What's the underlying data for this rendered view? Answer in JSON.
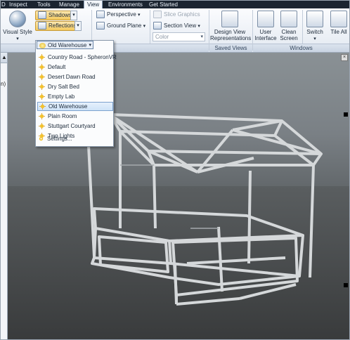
{
  "tabs": [
    {
      "label": "D"
    },
    {
      "label": "Inspect"
    },
    {
      "label": "Tools"
    },
    {
      "label": "Manage"
    },
    {
      "label": "View",
      "active": true
    },
    {
      "label": "Environments"
    },
    {
      "label": "Get Started"
    }
  ],
  "ribbon": {
    "visual_style": {
      "label": "Visual Style",
      "icon": "sphere-icon"
    },
    "shadows": {
      "label": "Shadows",
      "icon": "shadows-icon"
    },
    "reflections": {
      "label": "Reflections",
      "icon": "reflections-icon"
    },
    "environment_select": {
      "value": "Old Warehouse"
    },
    "perspective": {
      "label": "Perspective"
    },
    "ground_plane": {
      "label": "Ground Plane"
    },
    "slice_graphics": {
      "label": "Slice Graphics"
    },
    "section_view": {
      "label": "Section View"
    },
    "color_combo": {
      "value": "Color"
    },
    "design_view": {
      "label_line1": "Design View",
      "label_line2": "Representations"
    },
    "saved_views_group": "Saved Views",
    "user_interface": {
      "label_line1": "User",
      "label_line2": "Interface"
    },
    "clean_screen": {
      "label_line1": "Clean",
      "label_line2": "Screen"
    },
    "switch": {
      "label": "Switch"
    },
    "tile_all": {
      "label": "Tile All"
    },
    "windows_group": "Windows"
  },
  "left_pane": {
    "question": "?",
    "text": "n)"
  },
  "dropdown": {
    "selected": "Old Warehouse",
    "items": [
      {
        "label": "Country Road - SpheronVR"
      },
      {
        "label": "Default"
      },
      {
        "label": "Desert Dawn Road"
      },
      {
        "label": "Dry Salt Bed"
      },
      {
        "label": "Empty Lab"
      },
      {
        "label": "Old Warehouse",
        "highlighted": true
      },
      {
        "label": "Plain Room"
      },
      {
        "label": "Stuttgart Courtyard"
      },
      {
        "label": "Two Lights"
      }
    ],
    "settings": "Settings..."
  },
  "colors": {
    "accent": "#f4c95d",
    "highlight": "#cfe3f8",
    "tabbar": "#1b2430"
  }
}
